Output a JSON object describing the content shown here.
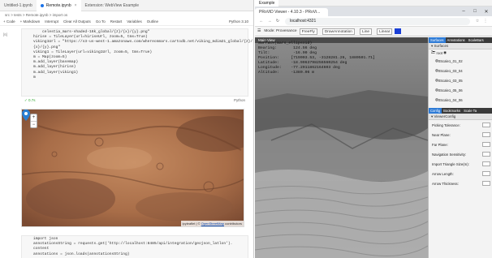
{
  "vscode": {
    "tabs": [
      {
        "label": "Untitled-1.ipynb"
      },
      {
        "label": "Remote.ipynb"
      },
      {
        "label": "Extension: WebView Example"
      }
    ],
    "breadcrumb": "src > tests > Remote.ipynb > import os",
    "toolbar": {
      "code": "+ Code",
      "markdown": "+ Markdown",
      "interrupt": "Interrupt",
      "clear": "Clear All Outputs",
      "goto": "Go To",
      "restart": "Restart",
      "variables": "Variables",
      "outline": "Outline",
      "kernel": "Python 3.10"
    },
    "cell1": {
      "gutter": "[6]",
      "lines": [
        "        celestia_mars-shaded-16k_global/{z}/{x}/{y}.png\"",
        "    hirise = TileLayer(url=hiriseUrl, zoom=5, tms=True)",
        "",
        "    viking1Url = \"https://s3-us-west-1.amazonaws.com/whereonmars.cartodb.net/viking_mdim21_global/{z}/",
        "    {x}/{y}.png\"",
        "    viking1 = TileLayer(url=viking1Url, zoom=5, tms=True)",
        "",
        "    m = Map(zoom=5)",
        "    m.add_layer(basemap)",
        "    m.add_layer(hirise)",
        "    m.add_layer(viking1)",
        "    m"
      ],
      "lang": "Python",
      "time": "0.7s"
    },
    "map": {
      "zoom_in": "+",
      "zoom_out": "−",
      "attribution_prefix": "ipyleaflet | ©",
      "attribution_link": "OpenStreetMap",
      "attribution_suffix": "contributors"
    },
    "cell2": {
      "lines": [
        "    import json",
        "    annotationsString = requests.get('http://localhost:8485/api/integration/geojson_latlon').",
        "    content",
        "    annotations = json.loads(annotationsString)"
      ]
    }
  },
  "browser": {
    "tab_label": "Example",
    "window_tab": "PRoViD Viewer - 4.10.3 - PRoVi...",
    "url": "localhost:4321",
    "app_toolbar": {
      "mode_label": "Mode: Provenance",
      "freefly": "FreeFly",
      "draw": "DrawAnnotation",
      "line": "Line",
      "linear": "Linear"
    },
    "main_view": "Main View",
    "overlay": [
      "Surface(mars_ellipsoid)",
      "Bearing:       124.56 deg",
      "Tilt:          -16.90 deg",
      "Position:     [719003.53, -3128281.26, 1880501.71]",
      "Latitude:     -18.9963798256560254 deg",
      "Longitude:    -77.2911862164603 deg",
      "Altitude:     -1380.06 m"
    ],
    "panel": {
      "tabs": [
        "Surfaces",
        "Annotations",
        "ScaleBars"
      ],
      "section": "Surfaces",
      "root": "root",
      "items": [
        "0Scale1_01_02",
        "0Scale1_03_04",
        "0Scale1_03_05",
        "0Scale1_05_06",
        "0Scale1_04_06"
      ],
      "bottom_tabs": [
        "Config",
        "Bookmarks",
        "Scale Ta"
      ],
      "config_section": "ViewerConfig",
      "config_items": [
        "Picking Tolerance:",
        "Near Plane:",
        "Far Plane:",
        "Navigation Sensitivity:",
        "Import Triangle Size(m):",
        "Arrow Length:",
        "Arrow Thickness:"
      ]
    }
  }
}
